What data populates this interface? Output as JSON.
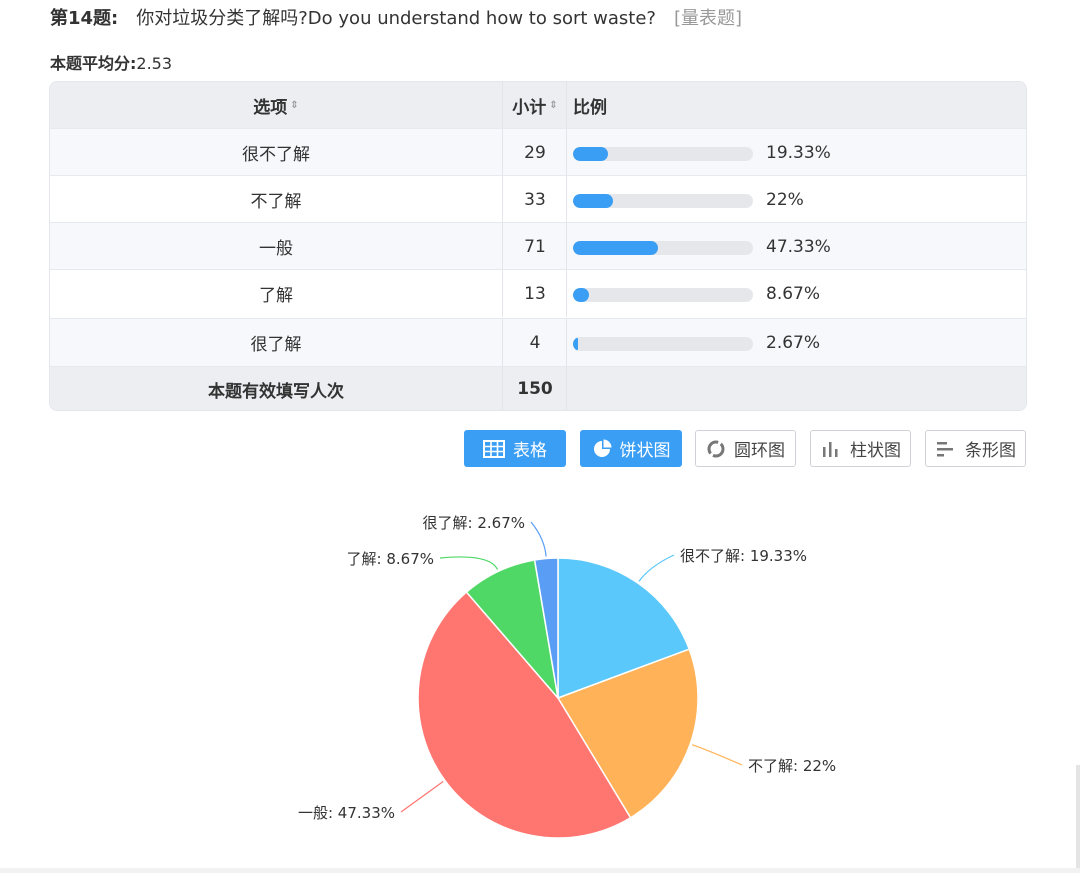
{
  "question": {
    "number": "第14题:",
    "text": "你对垃圾分类了解吗?Do you understand how to sort waste?",
    "type": "[量表题]"
  },
  "average": {
    "label": "本题平均分:",
    "value": "2.53"
  },
  "table": {
    "headers": {
      "option": "选项",
      "count": "小计",
      "ratio": "比例"
    },
    "sort_icon": "⇕",
    "rows": [
      {
        "option": "很不了解",
        "count": "29",
        "percent": "19.33%",
        "fraction": 0.1933
      },
      {
        "option": "不了解",
        "count": "33",
        "percent": "22%",
        "fraction": 0.22
      },
      {
        "option": "一般",
        "count": "71",
        "percent": "47.33%",
        "fraction": 0.4733
      },
      {
        "option": "了解",
        "count": "13",
        "percent": "8.67%",
        "fraction": 0.0867
      },
      {
        "option": "很了解",
        "count": "4",
        "percent": "2.67%",
        "fraction": 0.0267
      }
    ],
    "footer": {
      "label": "本题有效填写人次",
      "total": "150"
    }
  },
  "buttons": [
    {
      "label": "表格",
      "icon": "table-icon",
      "active": true
    },
    {
      "label": "饼状图",
      "icon": "pie-chart-icon",
      "active": true
    },
    {
      "label": "圆环图",
      "icon": "donut-chart-icon",
      "active": false
    },
    {
      "label": "柱状图",
      "icon": "bar-chart-icon",
      "active": false
    },
    {
      "label": "条形图",
      "icon": "horizontal-bar-chart-icon",
      "active": false
    }
  ],
  "colors": {
    "accent": "#3a9ef5",
    "bar_track": "#e5e7ea"
  },
  "chart_data": {
    "type": "pie",
    "categories": [
      "很不了解",
      "不了解",
      "一般",
      "了解",
      "很了解"
    ],
    "values": [
      19.33,
      22,
      47.33,
      8.67,
      2.67
    ],
    "labels": [
      "很不了解: 19.33%",
      "不了解: 22%",
      "一般: 47.33%",
      "了解: 8.67%",
      "很了解: 2.67%"
    ],
    "colors": [
      "#5ac8fa",
      "#ffb257",
      "#ff7570",
      "#4fd866",
      "#5a9df5"
    ],
    "start": "12 o'clock, clockwise"
  }
}
